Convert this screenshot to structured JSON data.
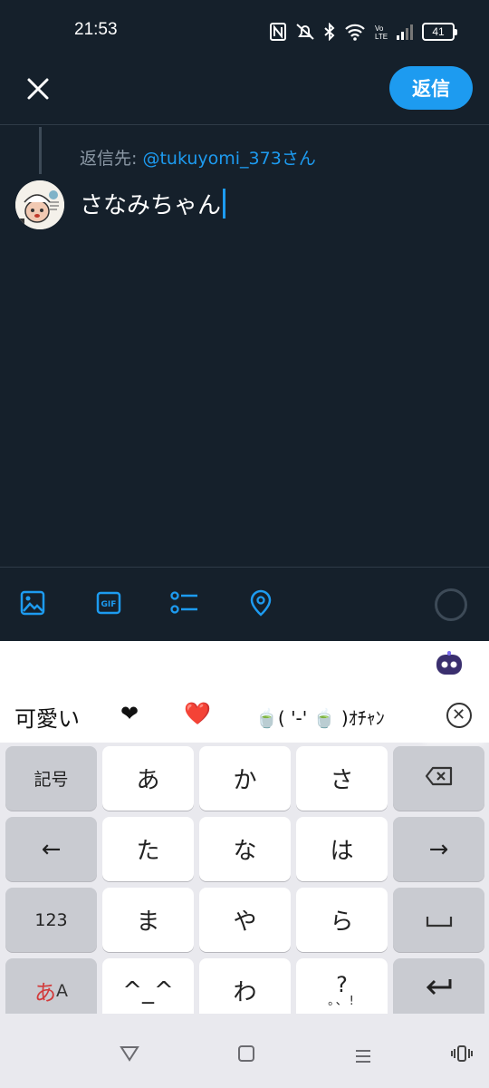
{
  "status_bar": {
    "time": "21:53",
    "battery": "41",
    "icons": [
      "nfc-icon",
      "mute-icon",
      "bluetooth-icon",
      "wifi-icon",
      "volte-icon",
      "signal-icon",
      "battery-icon"
    ]
  },
  "header": {
    "close_icon": "close-icon",
    "reply_button_label": "返信"
  },
  "compose": {
    "reply_to_prefix": "返信先: ",
    "reply_to_handle": "@tukuyomi_373さん",
    "text": "さなみちゃん"
  },
  "toolbar": {
    "items": [
      "image-icon",
      "gif-icon",
      "poll-icon",
      "location-icon"
    ]
  },
  "keyboard": {
    "suggestions": [
      "可愛い",
      "❤",
      "❤️",
      "🍵( '-' 🍵 )ｵﾁｬﾝ"
    ],
    "rows": [
      [
        "記号",
        "あ",
        "か",
        "さ",
        "⌫"
      ],
      [
        "←",
        "た",
        "な",
        "は",
        "→"
      ],
      [
        "123",
        "ま",
        "や",
        "ら",
        "␣"
      ],
      [
        "あA",
        "^_^",
        "わ",
        "?。、!",
        "↵"
      ]
    ],
    "mode_hira": "あ",
    "mode_latin": "A",
    "punct_top": "?",
    "punct_bottom": "。、!"
  },
  "colors": {
    "background": "#15202b",
    "accent": "#1d9bf0",
    "muted_text": "#8b98a5",
    "keyboard_bg": "#e9e9ee"
  }
}
